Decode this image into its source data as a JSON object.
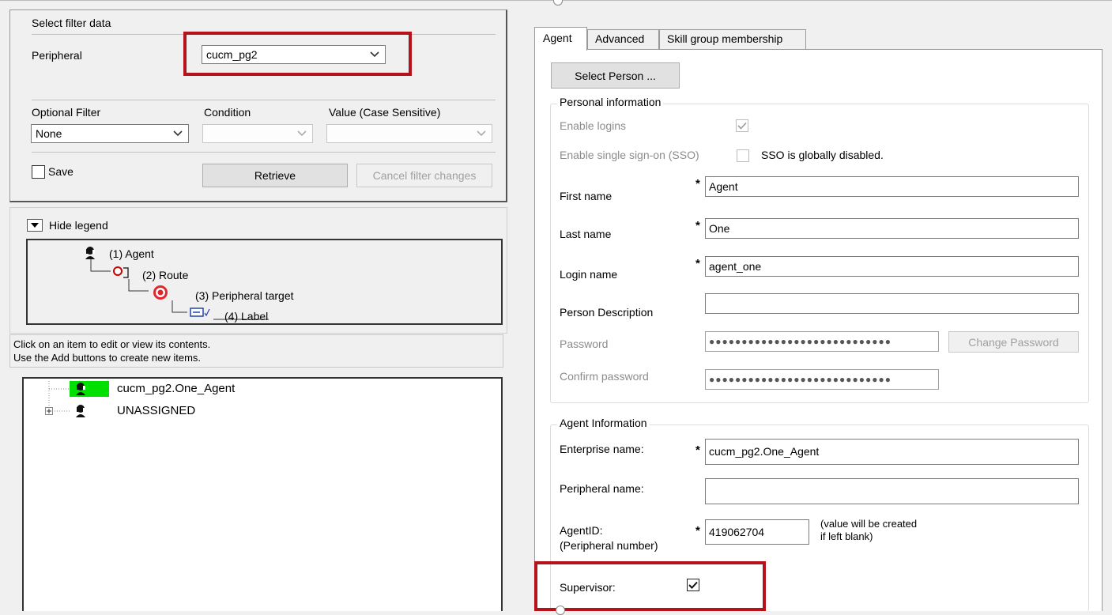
{
  "filter": {
    "group_title": "Select filter data",
    "peripheral_label": "Peripheral",
    "peripheral_value": "cucm_pg2",
    "optional_filter_label": "Optional Filter",
    "condition_label": "Condition",
    "value_label": "Value (Case Sensitive)",
    "optional_filter_value": "None",
    "condition_value": "",
    "value_value": "",
    "save_label": "Save",
    "retrieve_label": "Retrieve",
    "cancel_label": "Cancel filter changes"
  },
  "legend": {
    "toggle_label": "Hide legend",
    "items": [
      "(1) Agent",
      "(2) Route",
      "(3) Peripheral target",
      "(4) Label"
    ]
  },
  "info": {
    "line1": "Click on an item to edit or view its contents.",
    "line2": "Use the Add buttons to create new items."
  },
  "tree": {
    "items": [
      "cucm_pg2.One_Agent",
      "UNASSIGNED"
    ],
    "highlight_color": "#00e000"
  },
  "tabs": [
    "Agent",
    "Advanced",
    "Skill group membership"
  ],
  "agent": {
    "select_person_label": "Select Person ...",
    "personal_title": "Personal information",
    "enable_logins_label": "Enable logins",
    "enable_logins_checked": true,
    "sso_label": "Enable single sign-on (SSO)",
    "sso_checked": false,
    "sso_note": "SSO is globally disabled.",
    "first_name_label": "First name",
    "first_name": "Agent",
    "last_name_label": "Last name",
    "last_name": "One",
    "login_name_label": "Login name",
    "login_name": "agent_one",
    "person_desc_label": "Person Description",
    "person_desc": "",
    "password_label": "Password",
    "password_mask": "●●●●●●●●●●●●●●●●●●●●●●●●●●●●",
    "change_password_label": "Change Password",
    "confirm_password_label": "Confirm password",
    "confirm_password_mask": "●●●●●●●●●●●●●●●●●●●●●●●●●●●●",
    "agent_info_title": "Agent Information",
    "enterprise_name_label": "Enterprise name:",
    "enterprise_name": "cucm_pg2.One_Agent",
    "peripheral_name_label": "Peripheral name:",
    "peripheral_name": "",
    "agent_id_label": "AgentID:",
    "agent_id_sub": "(Peripheral number)",
    "agent_id": "419062704",
    "agent_id_note_1": "(value will be created",
    "agent_id_note_2": "if left blank)",
    "supervisor_label": "Supervisor:",
    "supervisor_checked": true,
    "required_marker": "*"
  },
  "colors": {
    "highlight_red": "#b5121b",
    "tree_highlight": "#00e000"
  }
}
